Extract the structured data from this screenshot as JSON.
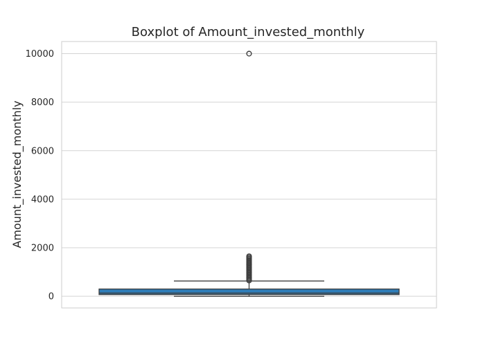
{
  "chart_data": {
    "type": "boxplot",
    "title": "Boxplot of Amount_invested_monthly",
    "xlabel": "",
    "ylabel": "Amount_invested_monthly",
    "ylim": [
      -480,
      10500
    ],
    "yticks": [
      0,
      2000,
      4000,
      6000,
      8000,
      10000
    ],
    "grid": true,
    "box": {
      "whisker_low": 0,
      "q1": 70,
      "median": 130,
      "q3": 300,
      "whisker_high": 630
    },
    "outliers": [
      650,
      700,
      750,
      800,
      850,
      900,
      950,
      1000,
      1050,
      1100,
      1150,
      1200,
      1250,
      1300,
      1350,
      1400,
      1450,
      1500,
      1550,
      1600,
      1650,
      10000
    ],
    "colors": {
      "box_fill": "#2f7db8",
      "line": "#3f3f3f",
      "grid": "#d4d4d4",
      "frame": "#cccccc"
    }
  }
}
